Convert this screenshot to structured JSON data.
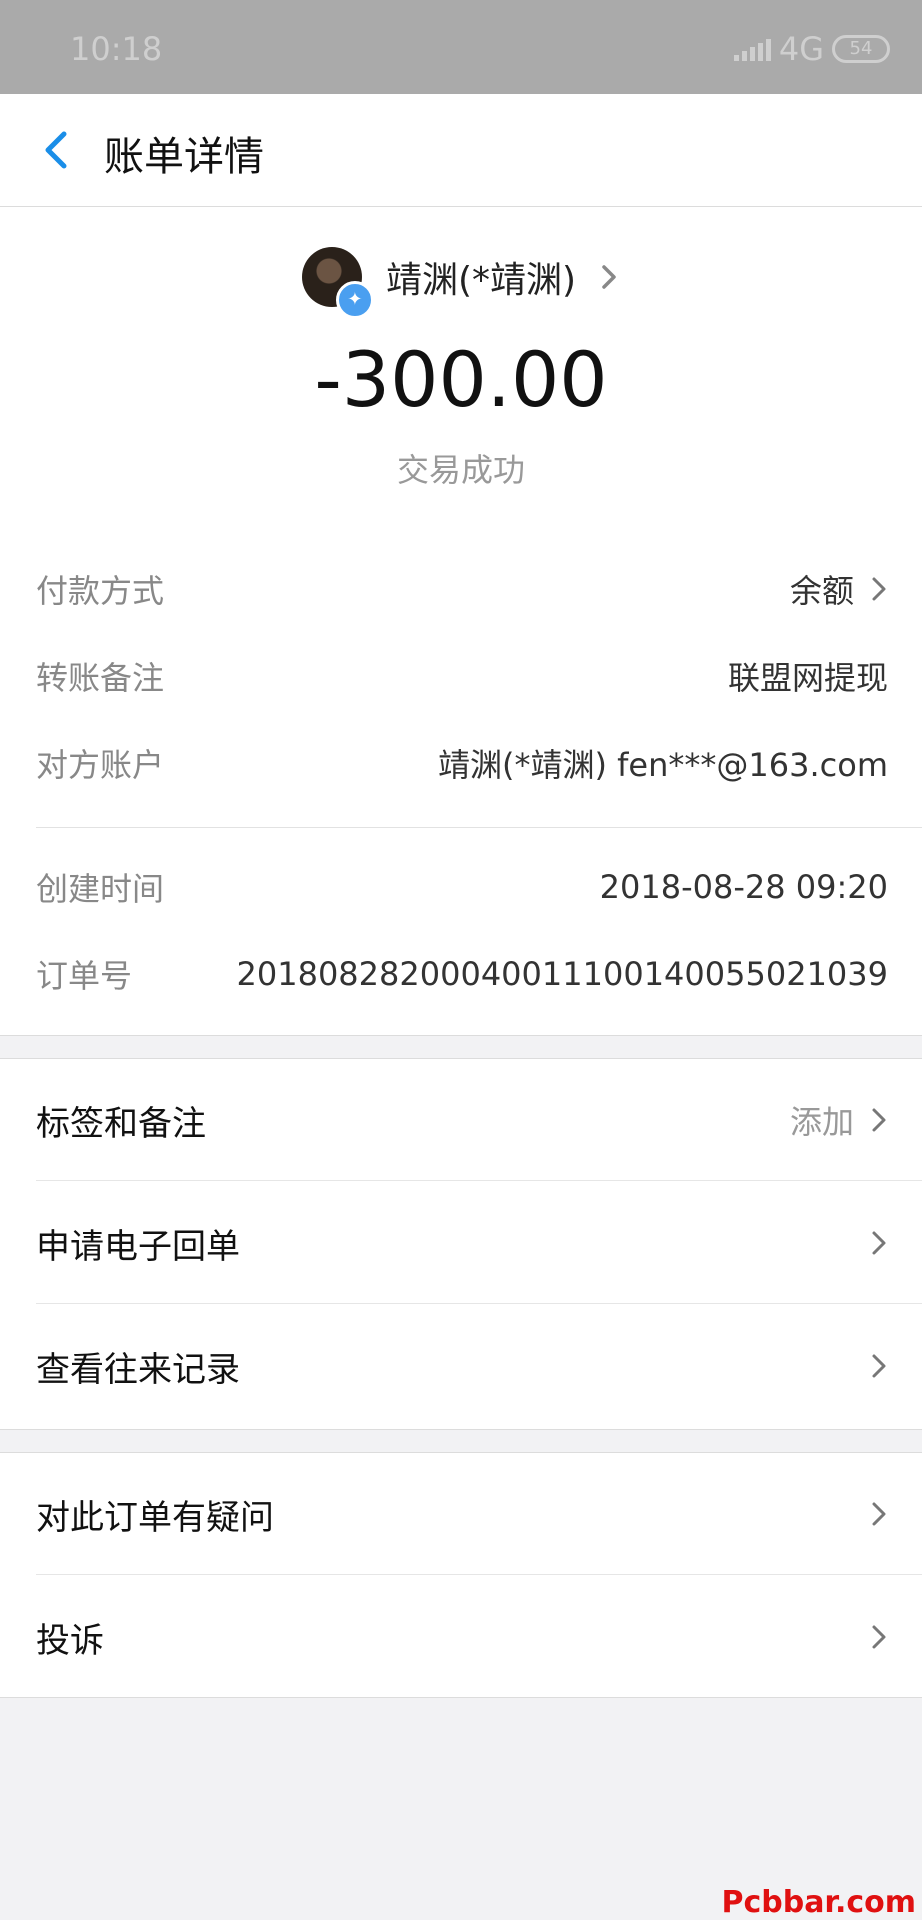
{
  "status_bar": {
    "time": "10:18",
    "network": "4G",
    "battery": "54"
  },
  "navbar": {
    "title": "账单详情",
    "back_icon": "chevron-left-icon"
  },
  "payee": {
    "name": "靖渊(*靖渊)"
  },
  "amount": "-300.00",
  "status": "交易成功",
  "details": {
    "payment_method": {
      "label": "付款方式",
      "value": "余额"
    },
    "transfer_note": {
      "label": "转账备注",
      "value": "联盟网提现"
    },
    "counterparty": {
      "label": "对方账户",
      "value": "靖渊(*靖渊) fen***@163.com"
    },
    "created_time": {
      "label": "创建时间",
      "value": "2018-08-28 09:20"
    },
    "order_no": {
      "label": "订单号",
      "value": "20180828200040011100140055021039"
    }
  },
  "actions1": {
    "tags": {
      "label": "标签和备注",
      "hint": "添加"
    },
    "receipt": {
      "label": "申请电子回单"
    },
    "history": {
      "label": "查看往来记录"
    }
  },
  "actions2": {
    "question": {
      "label": "对此订单有疑问"
    },
    "complaint": {
      "label": "投诉"
    }
  },
  "watermark": "Pcbbar.com",
  "colors": {
    "accent": "#1a8ee8",
    "verified_badge": "#4a9ff0",
    "watermark": "#e01010"
  }
}
